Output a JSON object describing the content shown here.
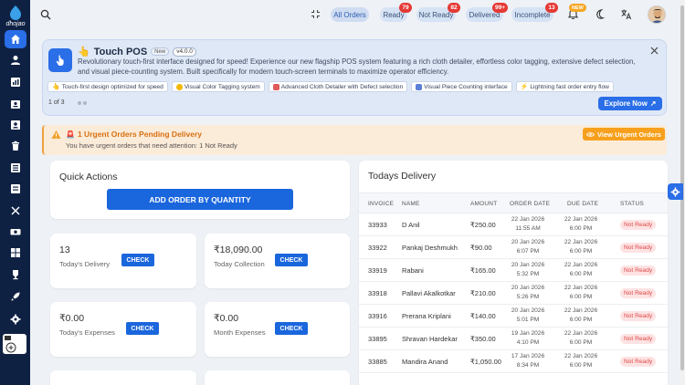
{
  "brand": {
    "name": "dhojao"
  },
  "topbar": {
    "pills": [
      {
        "label": "All Orders",
        "badge": ""
      },
      {
        "label": "Ready",
        "badge": "79"
      },
      {
        "label": "Not Ready",
        "badge": "82"
      },
      {
        "label": "Delivered",
        "badge": "99+"
      },
      {
        "label": "Incomplete",
        "badge": "13"
      }
    ],
    "new_badge": "NEW"
  },
  "promo": {
    "title": "Touch POS",
    "tag": "New",
    "version": "v4.0.0",
    "description": "Revolutionary touch-first interface designed for speed! Experience our new flagship POS system featuring a rich cloth detailer, effortless color tagging, extensive defect selection, and visual piece-counting system. Built specifically for modern touch-screen terminals to maximize operator efficiency.",
    "chips": [
      "Touch-first design optimized for speed",
      "Visual Color Tagging system",
      "Advanced Cloth Detailer with Defect selection",
      "Visual Piece Counting interface",
      "Lightning fast order entry flow"
    ],
    "pager": "1 of 3",
    "explore_label": "Explore Now"
  },
  "urgent": {
    "title": "1 Urgent Orders Pending Delivery",
    "subtitle": "You have urgent orders that need attention: 1 Not Ready",
    "button": "View Urgent Orders"
  },
  "quick_actions": {
    "title": "Quick Actions",
    "add_order_label": "ADD ORDER BY QUANTITY"
  },
  "stats": [
    {
      "value": "13",
      "label": "Today's Delivery",
      "button": "CHECK"
    },
    {
      "value": "₹18,090.00",
      "label": "Today Collection",
      "button": "CHECK"
    },
    {
      "value": "₹0.00",
      "label": "Today's Expenses",
      "button": "CHECK"
    },
    {
      "value": "₹0.00",
      "label": "Month Expenses",
      "button": "CHECK"
    }
  ],
  "delivery": {
    "title": "Todays Delivery",
    "columns": [
      "INVOICE",
      "NAME",
      "AMOUNT",
      "ORDER DATE",
      "DUE DATE",
      "STATUS"
    ],
    "rows": [
      {
        "invoice": "33933",
        "name": "D Anil",
        "amount": "₹250.00",
        "order_date": "22 Jan 2026",
        "order_time": "11:55 AM",
        "due_date": "22 Jan 2026",
        "due_time": "6:00 PM",
        "status": "Not Ready"
      },
      {
        "invoice": "33922",
        "name": "Pankaj Deshmukh",
        "amount": "₹90.00",
        "order_date": "20 Jan 2026",
        "order_time": "6:07 PM",
        "due_date": "22 Jan 2026",
        "due_time": "6:00 PM",
        "status": "Not Ready"
      },
      {
        "invoice": "33919",
        "name": "Rabani",
        "amount": "₹165.00",
        "order_date": "20 Jan 2026",
        "order_time": "5:32 PM",
        "due_date": "22 Jan 2026",
        "due_time": "6:00 PM",
        "status": "Not Ready"
      },
      {
        "invoice": "33918",
        "name": "Pallavi Akalkotkar",
        "amount": "₹210.00",
        "order_date": "20 Jan 2026",
        "order_time": "5:26 PM",
        "due_date": "22 Jan 2026",
        "due_time": "6:00 PM",
        "status": "Not Ready"
      },
      {
        "invoice": "33916",
        "name": "Prerana Kriplani",
        "amount": "₹140.00",
        "order_date": "20 Jan 2026",
        "order_time": "5:01 PM",
        "due_date": "22 Jan 2026",
        "due_time": "6:00 PM",
        "status": "Not Ready"
      },
      {
        "invoice": "33895",
        "name": "Shravan Hardekar",
        "amount": "₹350.00",
        "order_date": "19 Jan 2026",
        "order_time": "4:10 PM",
        "due_date": "22 Jan 2026",
        "due_time": "6:00 PM",
        "status": "Not Ready"
      },
      {
        "invoice": "33885",
        "name": "Mandira Anand",
        "amount": "₹1,050.00",
        "order_date": "17 Jan 2026",
        "order_time": "8:34 PM",
        "due_date": "22 Jan 2026",
        "due_time": "6:00 PM",
        "status": "Not Ready"
      }
    ]
  },
  "colors": {
    "accent": "#2a6ee8",
    "sidebar": "#0f2143",
    "warning": "#f7a01d",
    "danger": "#e53935"
  }
}
